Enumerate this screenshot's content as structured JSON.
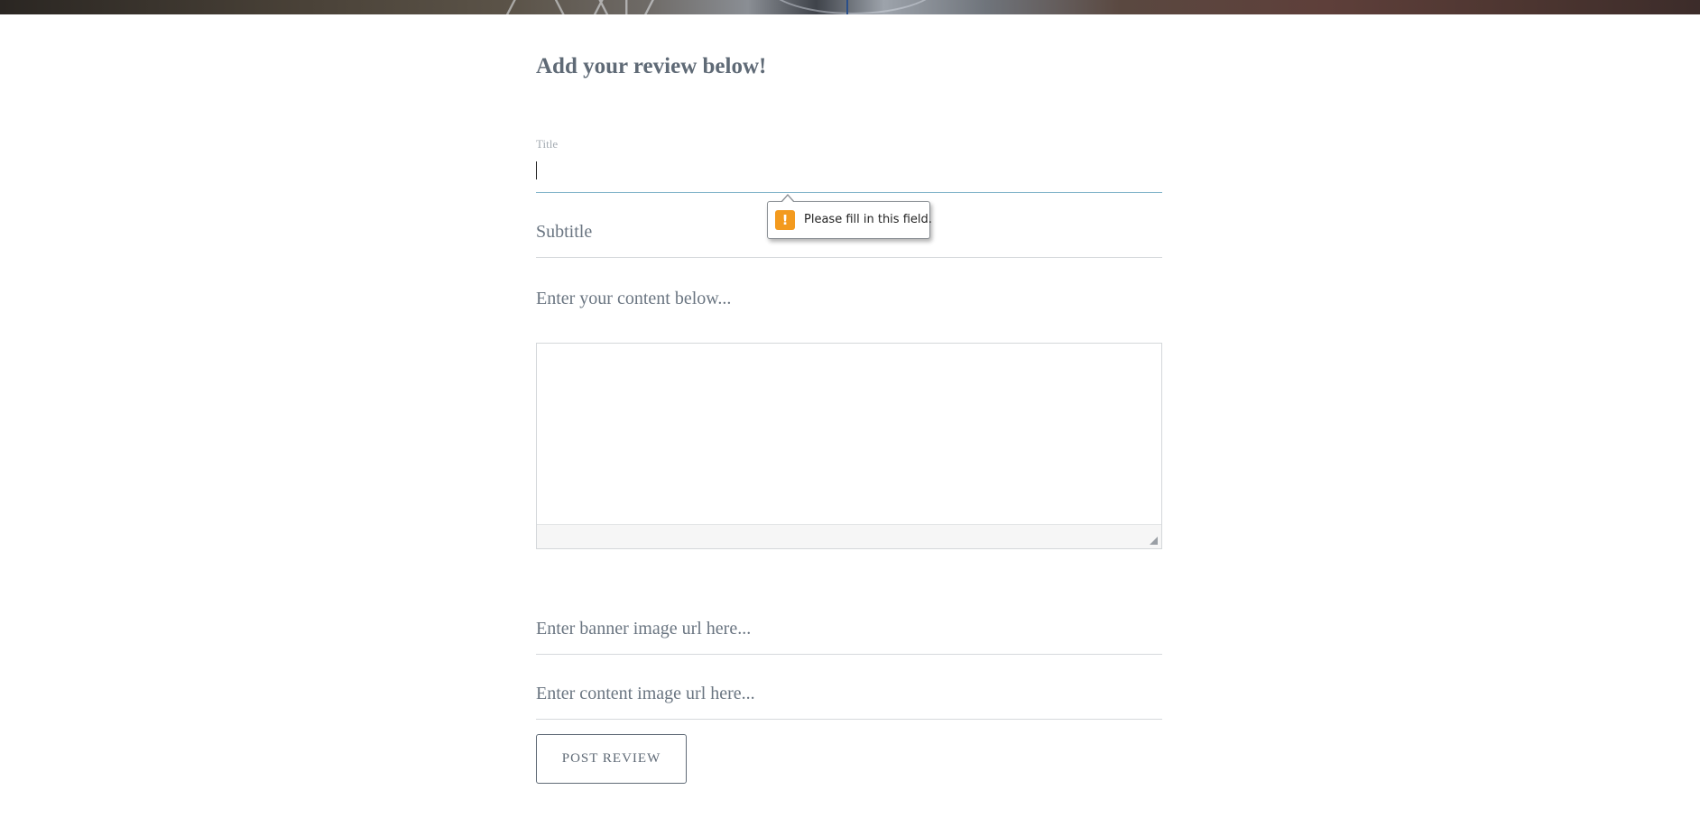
{
  "form": {
    "heading": "Add your review below!",
    "title_label": "Title",
    "title_value": "",
    "subtitle_placeholder": "Subtitle",
    "content_prompt": "Enter your content below...",
    "content_value": "",
    "banner_placeholder": "Enter banner image url here...",
    "content_image_placeholder": "Enter content image url here...",
    "submit_label": "Post Review"
  },
  "validation": {
    "message": "Please fill in this field.",
    "icon": "warning-icon",
    "icon_glyph": "!",
    "icon_color": "#f39a1e"
  },
  "colors": {
    "text": "#5f6a76",
    "focus_underline": "#7fb3c8"
  }
}
